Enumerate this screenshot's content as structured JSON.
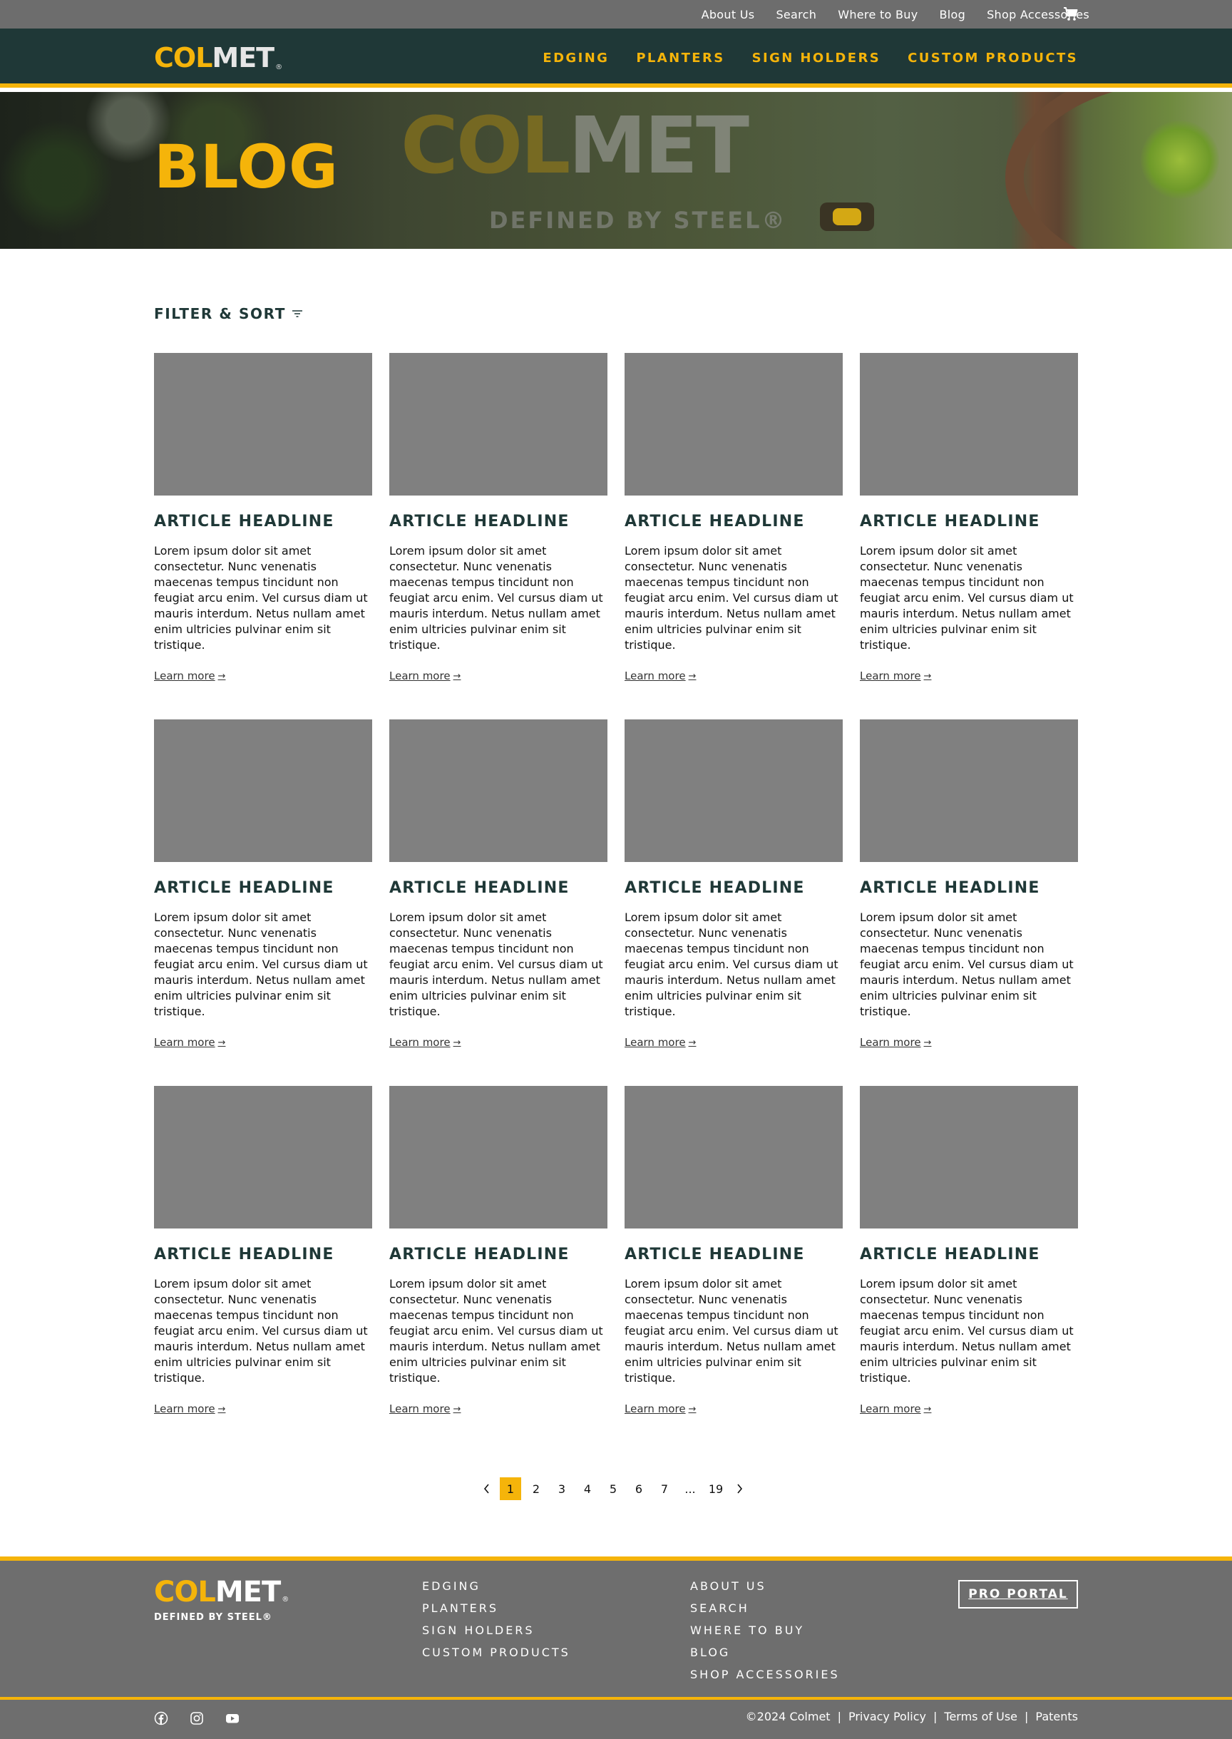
{
  "utility_nav": {
    "links": [
      "About Us",
      "Search",
      "Where to Buy",
      "Blog",
      "Shop Accessories"
    ],
    "cart_icon": "cart-icon"
  },
  "brand": {
    "logo_part1": "COL",
    "logo_part2": "MET",
    "registered": "®",
    "tagline": "DEFINED BY STEEL®",
    "colors": {
      "accent": "#f5b40a",
      "nav_bg": "#1f3837",
      "utility_bg": "#6d6d6d",
      "footer_bg": "#6e6e6e",
      "placeholder": "#808080"
    }
  },
  "main_nav": {
    "links": [
      "EDGING",
      "PLANTERS",
      "SIGN HOLDERS",
      "CUSTOM PRODUCTS"
    ]
  },
  "hero": {
    "title": "BLOG",
    "watermark_part1": "COL",
    "watermark_part2": "MET",
    "watermark_tagline": "DEFINED BY STEEL®"
  },
  "filter": {
    "label": "FILTER & SORT",
    "icon": "filter-icon"
  },
  "articles": [
    {
      "headline": "ARTICLE HEADLINE",
      "body": "Lorem ipsum dolor sit amet consectetur. Nunc venenatis maecenas tempus tincidunt non feugiat arcu enim. Vel cursus diam ut mauris interdum. Netus nullam amet enim ultricies pulvinar enim sit tristique.",
      "link": "Learn more"
    },
    {
      "headline": "ARTICLE HEADLINE",
      "body": "Lorem ipsum dolor sit amet consectetur. Nunc venenatis maecenas tempus tincidunt non feugiat arcu enim. Vel cursus diam ut mauris interdum. Netus nullam amet enim ultricies pulvinar enim sit tristique.",
      "link": "Learn more"
    },
    {
      "headline": "ARTICLE HEADLINE",
      "body": "Lorem ipsum dolor sit amet consectetur. Nunc venenatis maecenas tempus tincidunt non feugiat arcu enim. Vel cursus diam ut mauris interdum. Netus nullam amet enim ultricies pulvinar enim sit tristique.",
      "link": "Learn more"
    },
    {
      "headline": "ARTICLE HEADLINE",
      "body": "Lorem ipsum dolor sit amet consectetur. Nunc venenatis maecenas tempus tincidunt non feugiat arcu enim. Vel cursus diam ut mauris interdum. Netus nullam amet enim ultricies pulvinar enim sit tristique.",
      "link": "Learn more"
    },
    {
      "headline": "ARTICLE HEADLINE",
      "body": "Lorem ipsum dolor sit amet consectetur. Nunc venenatis maecenas tempus tincidunt non feugiat arcu enim. Vel cursus diam ut mauris interdum. Netus nullam amet enim ultricies pulvinar enim sit tristique.",
      "link": "Learn more"
    },
    {
      "headline": "ARTICLE HEADLINE",
      "body": "Lorem ipsum dolor sit amet consectetur. Nunc venenatis maecenas tempus tincidunt non feugiat arcu enim. Vel cursus diam ut mauris interdum. Netus nullam amet enim ultricies pulvinar enim sit tristique.",
      "link": "Learn more"
    },
    {
      "headline": "ARTICLE HEADLINE",
      "body": "Lorem ipsum dolor sit amet consectetur. Nunc venenatis maecenas tempus tincidunt non feugiat arcu enim. Vel cursus diam ut mauris interdum. Netus nullam amet enim ultricies pulvinar enim sit tristique.",
      "link": "Learn more"
    },
    {
      "headline": "ARTICLE HEADLINE",
      "body": "Lorem ipsum dolor sit amet consectetur. Nunc venenatis maecenas tempus tincidunt non feugiat arcu enim. Vel cursus diam ut mauris interdum. Netus nullam amet enim ultricies pulvinar enim sit tristique.",
      "link": "Learn more"
    },
    {
      "headline": "ARTICLE HEADLINE",
      "body": "Lorem ipsum dolor sit amet consectetur. Nunc venenatis maecenas tempus tincidunt non feugiat arcu enim. Vel cursus diam ut mauris interdum. Netus nullam amet enim ultricies pulvinar enim sit tristique.",
      "link": "Learn more"
    },
    {
      "headline": "ARTICLE HEADLINE",
      "body": "Lorem ipsum dolor sit amet consectetur. Nunc venenatis maecenas tempus tincidunt non feugiat arcu enim. Vel cursus diam ut mauris interdum. Netus nullam amet enim ultricies pulvinar enim sit tristique.",
      "link": "Learn more"
    },
    {
      "headline": "ARTICLE HEADLINE",
      "body": "Lorem ipsum dolor sit amet consectetur. Nunc venenatis maecenas tempus tincidunt non feugiat arcu enim. Vel cursus diam ut mauris interdum. Netus nullam amet enim ultricies pulvinar enim sit tristique.",
      "link": "Learn more"
    },
    {
      "headline": "ARTICLE HEADLINE",
      "body": "Lorem ipsum dolor sit amet consectetur. Nunc venenatis maecenas tempus tincidunt non feugiat arcu enim. Vel cursus diam ut mauris interdum. Netus nullam amet enim ultricies pulvinar enim sit tristique.",
      "link": "Learn more"
    }
  ],
  "pagination": {
    "pages": [
      "1",
      "2",
      "3",
      "4",
      "5",
      "6",
      "7",
      "...",
      "19"
    ],
    "current": "1"
  },
  "footer": {
    "products": [
      "EDGING",
      "PLANTERS",
      "SIGN HOLDERS",
      "CUSTOM PRODUCTS"
    ],
    "company": [
      "ABOUT US",
      "SEARCH",
      "WHERE TO BUY",
      "BLOG",
      "SHOP ACCESSORIES"
    ],
    "pro_portal": "PRO PORTAL",
    "socials": [
      "facebook-icon",
      "instagram-icon",
      "youtube-icon"
    ],
    "copyright": "©2024 Colmet",
    "legal_links": [
      "Privacy Policy",
      "Terms of Use",
      "Patents"
    ],
    "separator": "|"
  }
}
